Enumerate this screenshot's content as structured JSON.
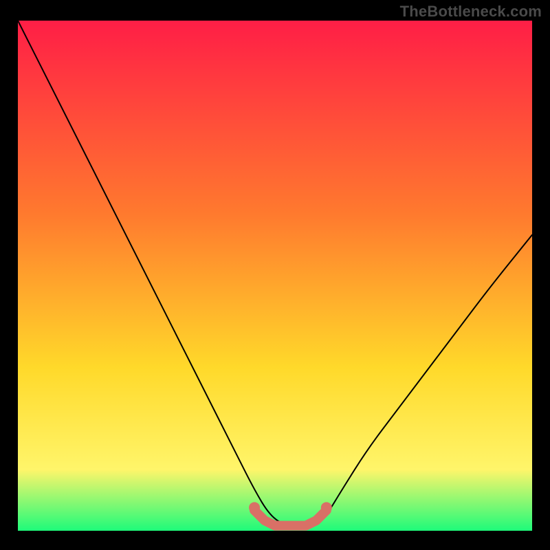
{
  "watermark": "TheBottleneck.com",
  "colors": {
    "background_black": "#000000",
    "gradient_top": "#ff1e46",
    "gradient_mid1": "#ff7a2e",
    "gradient_mid2": "#ffd92a",
    "gradient_mid3": "#fff56a",
    "gradient_bottom": "#1efb7a",
    "curve_stroke": "#000000",
    "marker_fill": "#d97066",
    "watermark_color": "#4a4a4a"
  },
  "chart_data": {
    "type": "line",
    "title": "",
    "xlabel": "",
    "ylabel": "",
    "xlim": [
      0,
      100
    ],
    "ylim": [
      0,
      100
    ],
    "series": [
      {
        "name": "bottleneck-curve",
        "x": [
          0,
          6,
          12,
          18,
          24,
          30,
          36,
          42,
          46,
          49,
          52,
          55,
          58,
          60,
          63,
          68,
          74,
          80,
          86,
          92,
          100
        ],
        "y": [
          100,
          88,
          76,
          64,
          52,
          40,
          28,
          16,
          8,
          3,
          1,
          1,
          1,
          3,
          8,
          16,
          24,
          32,
          40,
          48,
          58
        ]
      }
    ],
    "markers": {
      "name": "bottom-marker-band",
      "x": [
        46,
        48,
        50,
        52,
        54,
        56,
        58,
        60
      ],
      "y": [
        4,
        2,
        1,
        1,
        1,
        1,
        2,
        4
      ]
    },
    "annotations": []
  }
}
